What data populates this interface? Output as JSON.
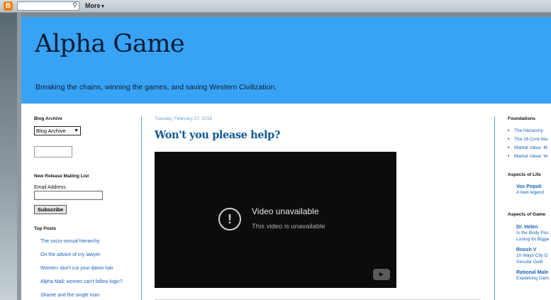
{
  "navbar": {
    "logo": "B",
    "search_value": "",
    "search_icon": "magnifier-icon",
    "more_label": "More"
  },
  "header": {
    "title": "Alpha Game",
    "tagline": "Breaking the chains, winning the games, and saving Western Civilization."
  },
  "left_sidebar": {
    "archive_heading": "Blog Archive",
    "archive_select": "Blog Archive",
    "mailing_heading": "New Release Mailing List",
    "email_label": "Email Address",
    "email_value": "",
    "subscribe_label": "Subscribe",
    "top_posts_heading": "Top Posts",
    "top_posts": [
      "The socio-sexual hierarchy",
      "On the advice of my lawyer",
      "Women: don't cut your damn hair",
      "Alpha Mail: women can't follow logic?",
      "Shame and the single man"
    ]
  },
  "post": {
    "date": "Tuesday, February 27, 2018",
    "title": "Won't you please help?",
    "video_message": "Video unavailable",
    "video_sub": "This video is unavailable"
  },
  "right_sidebar": {
    "foundations_heading": "Foundations",
    "foundations": [
      "The Hierarchy",
      "The 16 Core Ma",
      "Market Value: M",
      "Market Value: W"
    ],
    "life_heading": "Aspects of Life",
    "life_blogs": [
      {
        "name": "Vox Popoli",
        "post": "A new legend"
      }
    ],
    "game_heading": "Aspects of Game",
    "game_blogs": [
      {
        "name": "Dr. Helen",
        "post1": "Is the Body Pos",
        "post2": "Losing Its Bigge"
      },
      {
        "name": "Roosh V",
        "post1": "10 Ways City D",
        "post2": "Secular Guilt"
      },
      {
        "name": "Rational Male",
        "post1": "Explaining Gam",
        "post2": ""
      }
    ]
  },
  "colors": {
    "header_bg": "#38a3f4",
    "link": "#1a62b8",
    "title": "#0f5a96",
    "rule": "#5fa2d6"
  }
}
